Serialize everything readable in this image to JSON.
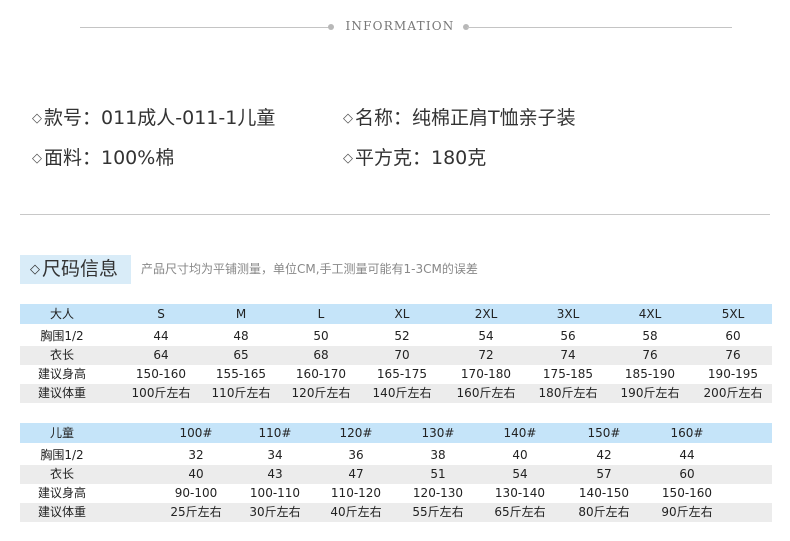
{
  "header": {
    "title": "INFORMATION"
  },
  "info": {
    "style_no": "款号：011成人-011-1儿童",
    "name": "名称：纯棉正肩T恤亲子装",
    "fabric": "面料：100%棉",
    "weight": "平方克：180克",
    "bullet": "◇"
  },
  "size_section": {
    "title": "尺码信息",
    "note": "产品尺寸均为平铺测量，单位CM,手工测量可能有1-3CM的误差"
  },
  "adult_table": {
    "header": [
      "大人",
      "S",
      "M",
      "L",
      "XL",
      "2XL",
      "3XL",
      "4XL",
      "5XL"
    ],
    "rows": [
      [
        "胸围1/2",
        "44",
        "48",
        "50",
        "52",
        "54",
        "56",
        "58",
        "60"
      ],
      [
        "衣长",
        "64",
        "65",
        "68",
        "70",
        "72",
        "74",
        "76",
        "76"
      ],
      [
        "建议身高",
        "150-160",
        "155-165",
        "160-170",
        "165-175",
        "170-180",
        "175-185",
        "185-190",
        "190-195"
      ],
      [
        "建议体重",
        "100斤左右",
        "110斤左右",
        "120斤左右",
        "140斤左右",
        "160斤左右",
        "180斤左右",
        "190斤左右",
        "200斤左右"
      ]
    ]
  },
  "child_table": {
    "header": [
      "儿童",
      "100#",
      "110#",
      "120#",
      "130#",
      "140#",
      "150#",
      "160#"
    ],
    "rows": [
      [
        "胸围1/2",
        "32",
        "34",
        "36",
        "38",
        "40",
        "42",
        "44"
      ],
      [
        "衣长",
        "40",
        "43",
        "47",
        "51",
        "54",
        "57",
        "60"
      ],
      [
        "建议身高",
        "90-100",
        "100-110",
        "110-120",
        "120-130",
        "130-140",
        "140-150",
        "150-160"
      ],
      [
        "建议体重",
        "25斤左右",
        "30斤左右",
        "40斤左右",
        "55斤左右",
        "65斤左右",
        "80斤左右",
        "90斤左右"
      ]
    ]
  }
}
